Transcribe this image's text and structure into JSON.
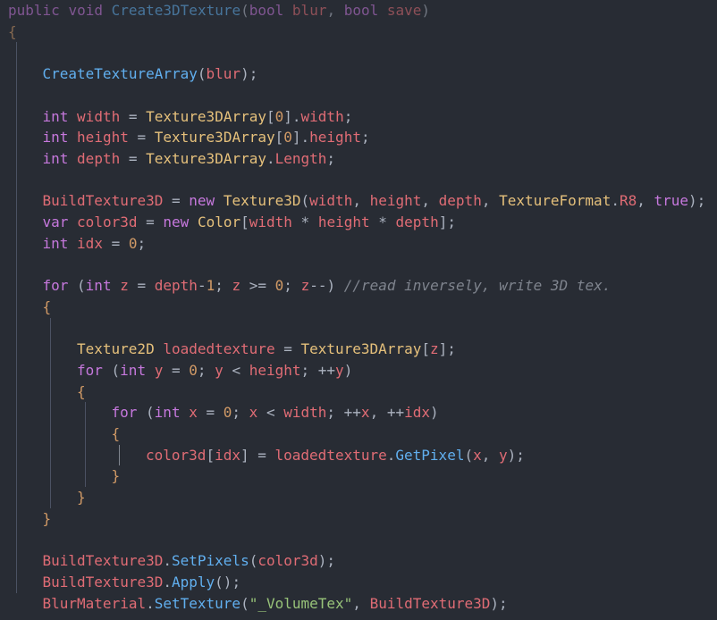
{
  "editor": {
    "language": "csharp",
    "lines": [
      {
        "indent": 0,
        "tokens": [
          [
            "kw",
            "public"
          ],
          [
            "pun",
            " "
          ],
          [
            "kw",
            "void"
          ],
          [
            "pun",
            " "
          ],
          [
            "fn",
            "Create3DTexture"
          ],
          [
            "pun",
            "("
          ],
          [
            "kw",
            "bool"
          ],
          [
            "pun",
            " "
          ],
          [
            "var",
            "blur"
          ],
          [
            "pun",
            ", "
          ],
          [
            "kw",
            "bool"
          ],
          [
            "pun",
            " "
          ],
          [
            "var",
            "save"
          ],
          [
            "pun",
            ")"
          ]
        ]
      },
      {
        "indent": 0,
        "tokens": [
          [
            "brc",
            "{"
          ]
        ]
      },
      {
        "indent": 0,
        "tokens": []
      },
      {
        "indent": 1,
        "tokens": [
          [
            "fn",
            "CreateTextureArray"
          ],
          [
            "pun",
            "("
          ],
          [
            "var",
            "blur"
          ],
          [
            "pun",
            ");"
          ]
        ]
      },
      {
        "indent": 0,
        "tokens": []
      },
      {
        "indent": 1,
        "tokens": [
          [
            "kw",
            "int"
          ],
          [
            "pun",
            " "
          ],
          [
            "var",
            "width"
          ],
          [
            "pun",
            " = "
          ],
          [
            "cls",
            "Texture3DArray"
          ],
          [
            "pun",
            "["
          ],
          [
            "num",
            "0"
          ],
          [
            "pun",
            "]."
          ],
          [
            "var",
            "width"
          ],
          [
            "pun",
            ";"
          ]
        ]
      },
      {
        "indent": 1,
        "tokens": [
          [
            "kw",
            "int"
          ],
          [
            "pun",
            " "
          ],
          [
            "var",
            "height"
          ],
          [
            "pun",
            " = "
          ],
          [
            "cls",
            "Texture3DArray"
          ],
          [
            "pun",
            "["
          ],
          [
            "num",
            "0"
          ],
          [
            "pun",
            "]."
          ],
          [
            "var",
            "height"
          ],
          [
            "pun",
            ";"
          ]
        ]
      },
      {
        "indent": 1,
        "tokens": [
          [
            "kw",
            "int"
          ],
          [
            "pun",
            " "
          ],
          [
            "var",
            "depth"
          ],
          [
            "pun",
            " = "
          ],
          [
            "cls",
            "Texture3DArray"
          ],
          [
            "pun",
            "."
          ],
          [
            "var",
            "Length"
          ],
          [
            "pun",
            ";"
          ]
        ]
      },
      {
        "indent": 0,
        "tokens": []
      },
      {
        "indent": 1,
        "tokens": [
          [
            "var",
            "BuildTexture3D"
          ],
          [
            "pun",
            " = "
          ],
          [
            "kw",
            "new"
          ],
          [
            "pun",
            " "
          ],
          [
            "cls",
            "Texture3D"
          ],
          [
            "pun",
            "("
          ],
          [
            "var",
            "width"
          ],
          [
            "pun",
            ", "
          ],
          [
            "var",
            "height"
          ],
          [
            "pun",
            ", "
          ],
          [
            "var",
            "depth"
          ],
          [
            "pun",
            ", "
          ],
          [
            "cls",
            "TextureFormat"
          ],
          [
            "pun",
            "."
          ],
          [
            "var",
            "R8"
          ],
          [
            "pun",
            ", "
          ],
          [
            "kw",
            "true"
          ],
          [
            "pun",
            ");"
          ]
        ]
      },
      {
        "indent": 1,
        "tokens": [
          [
            "kw",
            "var"
          ],
          [
            "pun",
            " "
          ],
          [
            "var",
            "color3d"
          ],
          [
            "pun",
            " = "
          ],
          [
            "kw",
            "new"
          ],
          [
            "pun",
            " "
          ],
          [
            "cls",
            "Color"
          ],
          [
            "pun",
            "["
          ],
          [
            "var",
            "width"
          ],
          [
            "pun",
            " * "
          ],
          [
            "var",
            "height"
          ],
          [
            "pun",
            " * "
          ],
          [
            "var",
            "depth"
          ],
          [
            "pun",
            "];"
          ]
        ]
      },
      {
        "indent": 1,
        "tokens": [
          [
            "kw",
            "int"
          ],
          [
            "pun",
            " "
          ],
          [
            "var",
            "idx"
          ],
          [
            "pun",
            " = "
          ],
          [
            "num",
            "0"
          ],
          [
            "pun",
            ";"
          ]
        ]
      },
      {
        "indent": 0,
        "tokens": []
      },
      {
        "indent": 1,
        "tokens": [
          [
            "kw",
            "for"
          ],
          [
            "pun",
            " ("
          ],
          [
            "kw",
            "int"
          ],
          [
            "pun",
            " "
          ],
          [
            "var",
            "z"
          ],
          [
            "pun",
            " = "
          ],
          [
            "var",
            "depth"
          ],
          [
            "pun",
            "-"
          ],
          [
            "num",
            "1"
          ],
          [
            "pun",
            "; "
          ],
          [
            "var",
            "z"
          ],
          [
            "pun",
            " >= "
          ],
          [
            "num",
            "0"
          ],
          [
            "pun",
            "; "
          ],
          [
            "var",
            "z"
          ],
          [
            "pun",
            "--) "
          ],
          [
            "cmt",
            "//read inversely, write 3D tex."
          ]
        ]
      },
      {
        "indent": 1,
        "tokens": [
          [
            "brc",
            "{"
          ]
        ]
      },
      {
        "indent": 0,
        "tokens": []
      },
      {
        "indent": 2,
        "tokens": [
          [
            "cls",
            "Texture2D"
          ],
          [
            "pun",
            " "
          ],
          [
            "var",
            "loadedtexture"
          ],
          [
            "pun",
            " = "
          ],
          [
            "cls",
            "Texture3DArray"
          ],
          [
            "pun",
            "["
          ],
          [
            "var",
            "z"
          ],
          [
            "pun",
            "];"
          ]
        ]
      },
      {
        "indent": 2,
        "tokens": [
          [
            "kw",
            "for"
          ],
          [
            "pun",
            " ("
          ],
          [
            "kw",
            "int"
          ],
          [
            "pun",
            " "
          ],
          [
            "var",
            "y"
          ],
          [
            "pun",
            " = "
          ],
          [
            "num",
            "0"
          ],
          [
            "pun",
            "; "
          ],
          [
            "var",
            "y"
          ],
          [
            "pun",
            " < "
          ],
          [
            "var",
            "height"
          ],
          [
            "pun",
            "; ++"
          ],
          [
            "var",
            "y"
          ],
          [
            "pun",
            ")"
          ]
        ]
      },
      {
        "indent": 2,
        "tokens": [
          [
            "brc",
            "{"
          ]
        ]
      },
      {
        "indent": 3,
        "tokens": [
          [
            "kw",
            "for"
          ],
          [
            "pun",
            " ("
          ],
          [
            "kw",
            "int"
          ],
          [
            "pun",
            " "
          ],
          [
            "var",
            "x"
          ],
          [
            "pun",
            " = "
          ],
          [
            "num",
            "0"
          ],
          [
            "pun",
            "; "
          ],
          [
            "var",
            "x"
          ],
          [
            "pun",
            " < "
          ],
          [
            "var",
            "width"
          ],
          [
            "pun",
            "; ++"
          ],
          [
            "var",
            "x"
          ],
          [
            "pun",
            ", ++"
          ],
          [
            "var",
            "idx"
          ],
          [
            "pun",
            ")"
          ]
        ]
      },
      {
        "indent": 3,
        "tokens": [
          [
            "brc",
            "{"
          ]
        ]
      },
      {
        "indent": 4,
        "tokens": [
          [
            "var",
            "color3d"
          ],
          [
            "pun",
            "["
          ],
          [
            "var",
            "idx"
          ],
          [
            "pun",
            "] = "
          ],
          [
            "var",
            "loadedtexture"
          ],
          [
            "pun",
            "."
          ],
          [
            "fn",
            "GetPixel"
          ],
          [
            "pun",
            "("
          ],
          [
            "var",
            "x"
          ],
          [
            "pun",
            ", "
          ],
          [
            "var",
            "y"
          ],
          [
            "pun",
            ");"
          ]
        ]
      },
      {
        "indent": 3,
        "tokens": [
          [
            "brc",
            "}"
          ]
        ]
      },
      {
        "indent": 2,
        "tokens": [
          [
            "brc",
            "}"
          ]
        ]
      },
      {
        "indent": 1,
        "tokens": [
          [
            "brc",
            "}"
          ]
        ]
      },
      {
        "indent": 0,
        "tokens": []
      },
      {
        "indent": 1,
        "tokens": [
          [
            "var",
            "BuildTexture3D"
          ],
          [
            "pun",
            "."
          ],
          [
            "fn",
            "SetPixels"
          ],
          [
            "pun",
            "("
          ],
          [
            "var",
            "color3d"
          ],
          [
            "pun",
            ");"
          ]
        ]
      },
      {
        "indent": 1,
        "tokens": [
          [
            "var",
            "BuildTexture3D"
          ],
          [
            "pun",
            "."
          ],
          [
            "fn",
            "Apply"
          ],
          [
            "pun",
            "();"
          ]
        ]
      },
      {
        "indent": 1,
        "tokens": [
          [
            "var",
            "BlurMaterial"
          ],
          [
            "pun",
            "."
          ],
          [
            "fn",
            "SetTexture"
          ],
          [
            "pun",
            "("
          ],
          [
            "str",
            "\"_VolumeTex\""
          ],
          [
            "pun",
            ", "
          ],
          [
            "var",
            "BuildTexture3D"
          ],
          [
            "pun",
            ");"
          ]
        ]
      }
    ]
  },
  "theme": {
    "background": "#282c34",
    "keyword": "#c678dd",
    "function": "#61afef",
    "type": "#e5c07b",
    "number": "#d19a66",
    "string": "#98c379",
    "comment": "#7f848e",
    "identifier": "#e06c75"
  }
}
